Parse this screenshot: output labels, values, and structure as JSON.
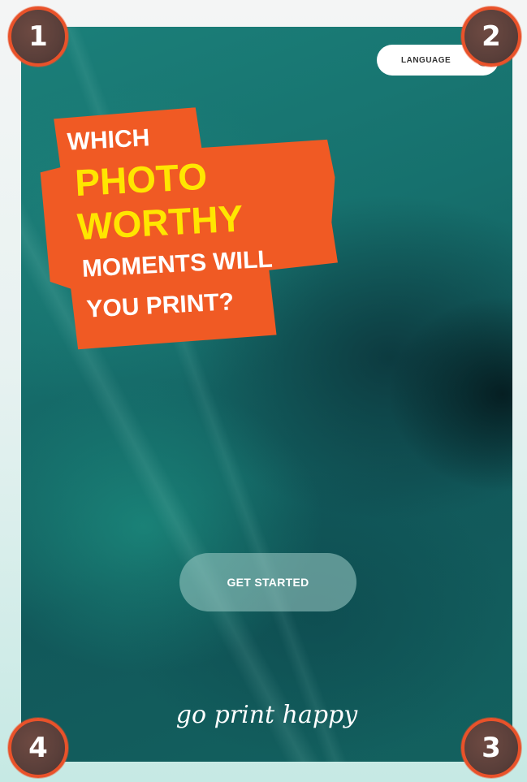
{
  "language_button": {
    "label": "LANGUAGE",
    "icon": "globe-icon"
  },
  "headline": {
    "line1": "WHICH",
    "line2": "PHOTO",
    "line3": "WORTHY",
    "line4": "MOMENTS WILL",
    "line5": "YOU PRINT?"
  },
  "cta": {
    "label": "GET STARTED"
  },
  "tagline": "go print happy",
  "corner_markers": [
    "1",
    "2",
    "3",
    "4"
  ],
  "colors": {
    "accent_orange": "#f05a24",
    "headline_yellow": "#ffe600",
    "background_teal": "#16706d",
    "marker_ring": "#e9522a"
  }
}
